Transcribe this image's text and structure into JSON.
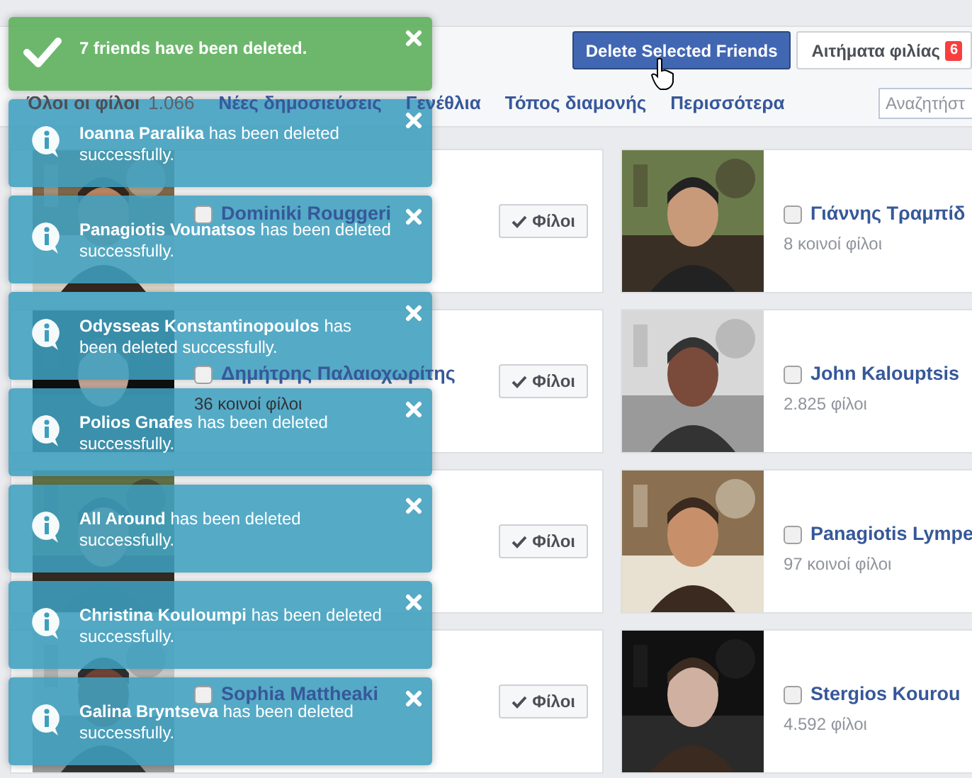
{
  "top_buttons": {
    "delete_selected": "Delete Selected Friends",
    "friend_requests": {
      "label": "Αιτήματα φιλίας",
      "badge": "6"
    }
  },
  "nav": [
    {
      "label": "Όλοι οι φίλοι",
      "count": "1.066",
      "selected": true
    },
    {
      "label": "Νέες δημοσιεύσεις",
      "selected": false
    },
    {
      "label": "Γενέθλια",
      "selected": false
    },
    {
      "label": "Τόπος διαμονής",
      "selected": false
    },
    {
      "label": "Περισσότερα",
      "selected": false
    }
  ],
  "search": {
    "placeholder": "Αναζητήστ"
  },
  "rows": [
    {
      "left": {
        "name": "Dominiki Rouggeri",
        "checked": false,
        "button": "Φίλοι"
      },
      "right": {
        "name": "Γιάννης Τραμπίδ",
        "info": "8 κοινοί φίλοι",
        "checked": false
      }
    },
    {
      "left": {
        "name": "Δημήτρης Παλαιοχωρίτης",
        "info": "36 κοινοί φίλοι",
        "checked": false,
        "button": "Φίλοι"
      },
      "right": {
        "name": "John Kalouptsis",
        "info": "2.825 φίλοι",
        "checked": false
      }
    },
    {
      "left": {
        "button": "Φίλοι"
      },
      "right": {
        "name": "Panagiotis Lympe",
        "info": "97 κοινοί φίλοι",
        "checked": false
      }
    },
    {
      "left": {
        "name": "Sophia Mattheaki",
        "checked": false,
        "button": "Φίλοι"
      },
      "right": {
        "name": "Stergios Kourou",
        "info": "4.592 φίλοι",
        "checked": false
      }
    }
  ],
  "notifications": [
    {
      "kind": "success",
      "text": "7 friends have been deleted."
    },
    {
      "kind": "info",
      "text": "**Ioanna Paralika** has been deleted successfully."
    },
    {
      "kind": "info",
      "text": "**Panagiotis Vounatsos** has been deleted successfully."
    },
    {
      "kind": "info",
      "text": "**Odysseas Konstantinopoulos** has been deleted successfully."
    },
    {
      "kind": "info",
      "text": "**Polios Gnafes** has been deleted successfully."
    },
    {
      "kind": "info",
      "text": "**All Around** has been deleted successfully."
    },
    {
      "kind": "info",
      "text": "**Christina Kouloumpi** has been deleted successfully."
    },
    {
      "kind": "info",
      "text": "**Galina Bryntseva** has been deleted successfully."
    }
  ]
}
